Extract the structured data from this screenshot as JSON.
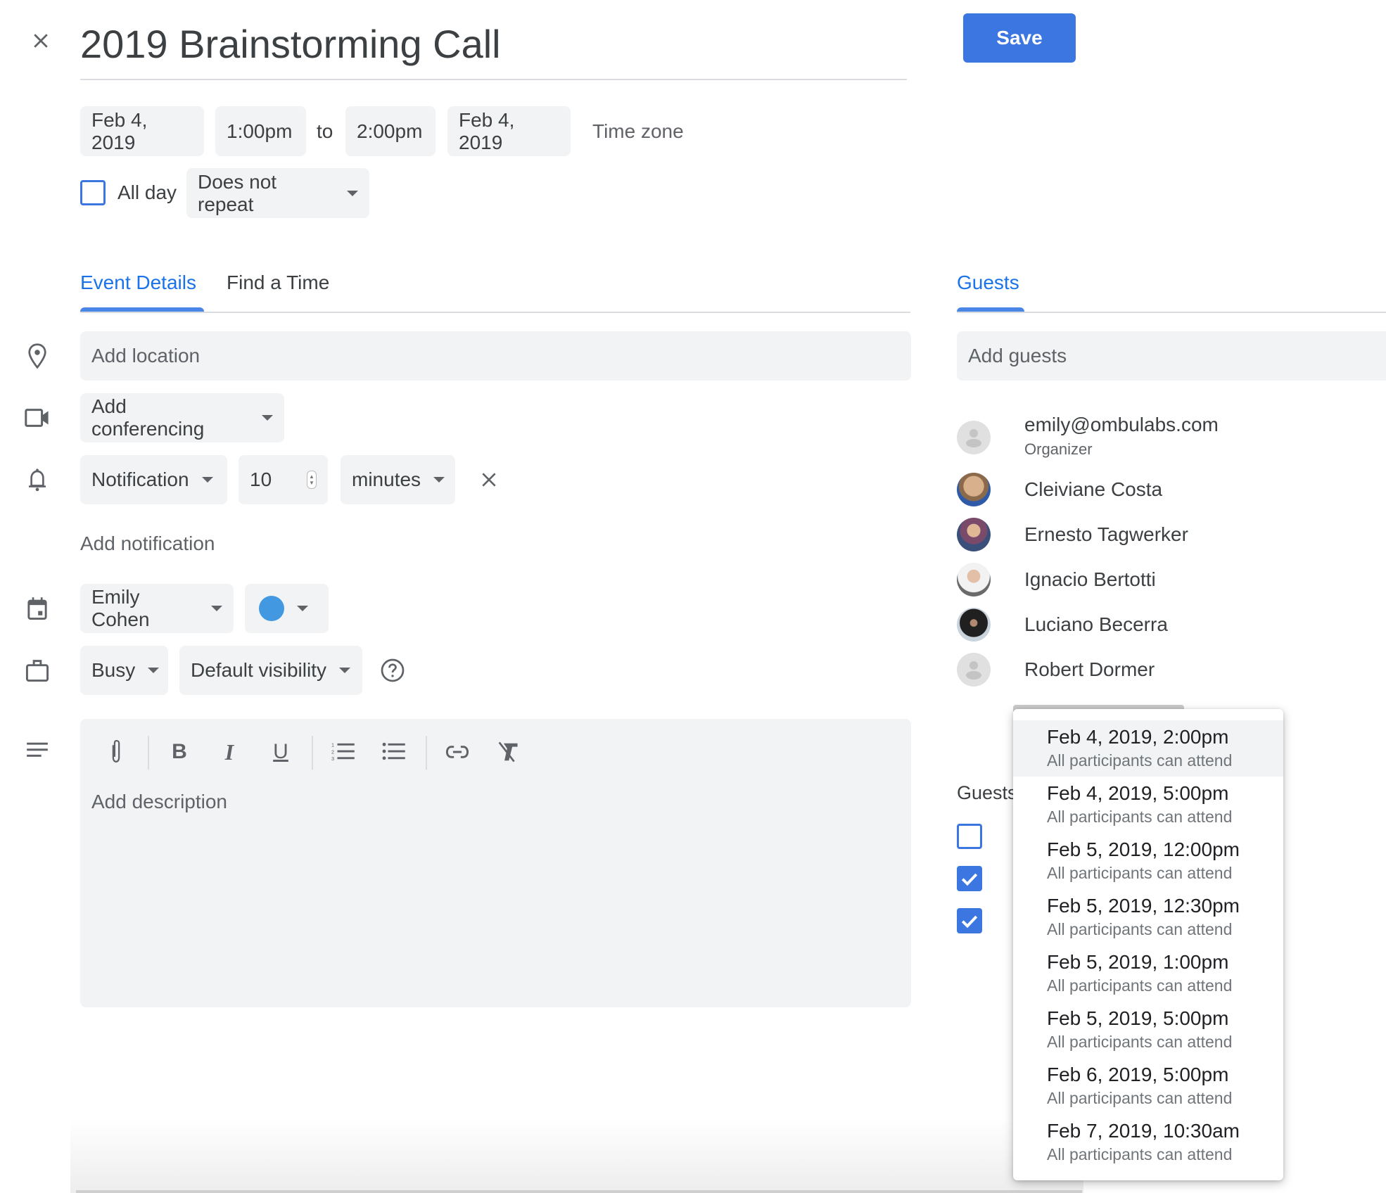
{
  "header": {
    "close_label": "Close",
    "title": "2019 Brainstorming Call",
    "save_label": "Save"
  },
  "datetime": {
    "start_date": "Feb 4, 2019",
    "start_time": "1:00pm",
    "to_label": "to",
    "end_time": "2:00pm",
    "end_date": "Feb 4, 2019",
    "timezone_label": "Time zone",
    "all_day_label": "All day",
    "all_day_checked": false,
    "repeat_value": "Does not repeat"
  },
  "tabs": {
    "event_details": "Event Details",
    "find_a_time": "Find a Time",
    "guests": "Guests",
    "active": "Event Details"
  },
  "details": {
    "location_placeholder": "Add location",
    "conferencing_label": "Add conferencing",
    "notification": {
      "type": "Notification",
      "amount": "10",
      "unit": "minutes"
    },
    "add_notification_label": "Add notification",
    "calendar_owner": "Emily Cohen",
    "event_color": "#4299e1",
    "availability": "Busy",
    "visibility": "Default visibility",
    "description_placeholder": "Add description"
  },
  "toolbar": {
    "buttons": [
      "attachment-icon",
      "bold-icon",
      "italic-icon",
      "underline-icon",
      "numbered-list-icon",
      "bulleted-list-icon",
      "link-icon",
      "remove-formatting-icon"
    ]
  },
  "guests": {
    "input_placeholder": "Add guests",
    "list": [
      {
        "name": "emily@ombulabs.com",
        "role": "Organizer",
        "avatar": "default"
      },
      {
        "name": "Cleiviane Costa",
        "avatar": "photo"
      },
      {
        "name": "Ernesto Tagwerker",
        "avatar": "photo"
      },
      {
        "name": "Ignacio Bertotti",
        "avatar": "photo"
      },
      {
        "name": "Luciano Becerra",
        "avatar": "photo"
      },
      {
        "name": "Robert Dormer",
        "avatar": "default"
      }
    ],
    "permissions_label": "Guests",
    "permissions_checked": [
      false,
      true,
      true
    ]
  },
  "suggested_times": {
    "items": [
      {
        "time": "Feb 4, 2019, 2:00pm",
        "status": "All participants can attend",
        "highlighted": true
      },
      {
        "time": "Feb 4, 2019, 5:00pm",
        "status": "All participants can attend"
      },
      {
        "time": "Feb 5, 2019, 12:00pm",
        "status": "All participants can attend"
      },
      {
        "time": "Feb 5, 2019, 12:30pm",
        "status": "All participants can attend"
      },
      {
        "time": "Feb 5, 2019, 1:00pm",
        "status": "All participants can attend"
      },
      {
        "time": "Feb 5, 2019, 5:00pm",
        "status": "All participants can attend"
      },
      {
        "time": "Feb 6, 2019, 5:00pm",
        "status": "All participants can attend"
      },
      {
        "time": "Feb 7, 2019, 10:30am",
        "status": "All participants can attend"
      }
    ]
  },
  "colors": {
    "accent": "#1a73e8",
    "save_button": "#3b76e1",
    "tab_indicator": "#4a86e8",
    "chip_bg": "#f1f3f4"
  }
}
